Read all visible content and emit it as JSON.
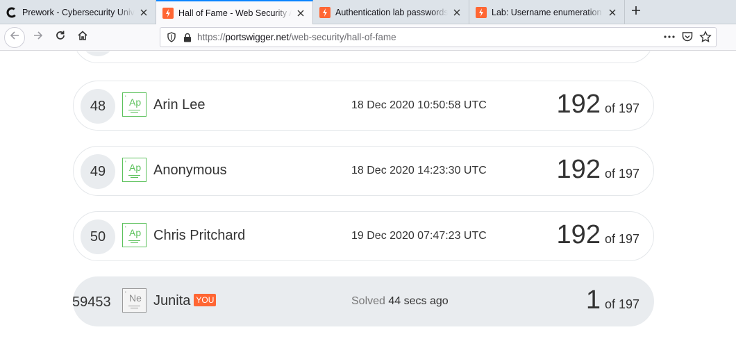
{
  "tabs": [
    {
      "title": "Prework - Cybersecurity Univer",
      "favicon": "c-logo-icon",
      "active": false
    },
    {
      "title": "Hall of Fame - Web Security Ac",
      "favicon": "portswigger-icon",
      "active": true
    },
    {
      "title": "Authentication lab passwords |",
      "favicon": "portswigger-icon",
      "active": false
    },
    {
      "title": "Lab: Username enumeration vi",
      "favicon": "portswigger-icon",
      "active": false
    }
  ],
  "address": {
    "scheme": "https://",
    "host": "portswigger.net",
    "path": "/web-security/hall-of-fame"
  },
  "rows": [
    {
      "rank": "48",
      "element": "Ap",
      "name": "Arin Lee",
      "date": "18 Dec 2020 10:50:58 UTC",
      "score": "192",
      "of": "of 197"
    },
    {
      "rank": "49",
      "element": "Ap",
      "name": "Anonymous",
      "date": "18 Dec 2020 14:23:30 UTC",
      "score": "192",
      "of": "of 197"
    },
    {
      "rank": "50",
      "element": "Ap",
      "name": "Chris Pritchard",
      "date": "19 Dec 2020 07:47:23 UTC",
      "score": "192",
      "of": "of 197"
    }
  ],
  "you": {
    "rank": "59453",
    "element": "Ne",
    "name": "Junita",
    "badge": "YOU",
    "solved_label": "Solved",
    "solved_ago": "44 secs ago",
    "score": "1",
    "of": "of 197"
  },
  "colors": {
    "accent": "#ff6633",
    "element_green": "#5cc15c",
    "tab_active": "#0a84ff"
  }
}
